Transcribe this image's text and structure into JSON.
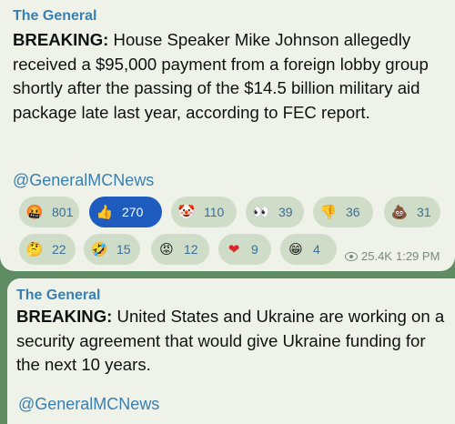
{
  "post1": {
    "channel": "The General",
    "breaking": "BREAKING:",
    "text": " House Speaker Mike Johnson allegedly received a $95,000 payment from a foreign lobby group shortly after the passing of the $14.5 billion military aid package late last year, according to FEC report.",
    "handle": "@GeneralMCNews",
    "views": "25.4K",
    "time": "1:29 PM",
    "reactions": [
      {
        "icon": "angry-cursing-face-icon",
        "glyph": "🤬",
        "count": "801",
        "selected": false
      },
      {
        "icon": "thumbs-up-icon",
        "glyph": "👍",
        "count": "270",
        "selected": true
      },
      {
        "icon": "clown-face-icon",
        "glyph": "🤡",
        "count": "110",
        "selected": false
      },
      {
        "icon": "eyes-icon",
        "glyph": "👀",
        "count": "39",
        "selected": false
      },
      {
        "icon": "thumbs-down-icon",
        "glyph": "👎",
        "count": "36",
        "selected": false
      },
      {
        "icon": "poop-icon",
        "glyph": "💩",
        "count": "31",
        "selected": false
      },
      {
        "icon": "thinking-face-icon",
        "glyph": "🤔",
        "count": "22",
        "selected": false
      },
      {
        "icon": "rofl-face-icon",
        "glyph": "🤣",
        "count": "15",
        "selected": false
      },
      {
        "icon": "angry-face-icon",
        "glyph": "😡",
        "count": "12",
        "selected": false
      },
      {
        "icon": "heart-icon",
        "glyph": "❤",
        "count": "9",
        "selected": false
      },
      {
        "icon": "grinning-face-icon",
        "glyph": "😁",
        "count": "4",
        "selected": false
      }
    ]
  },
  "post2": {
    "channel": "The General",
    "breaking": "BREAKING:",
    "text": " United States and Ukraine are working on a security agreement that would give Ukraine funding for the next 10 years.",
    "handle": "@GeneralMCNews"
  },
  "colors": {
    "background": "#5f8c63",
    "bubble": "#eef2e8",
    "accent": "#3a7fb2",
    "selected_reaction": "#1d5bbf"
  }
}
